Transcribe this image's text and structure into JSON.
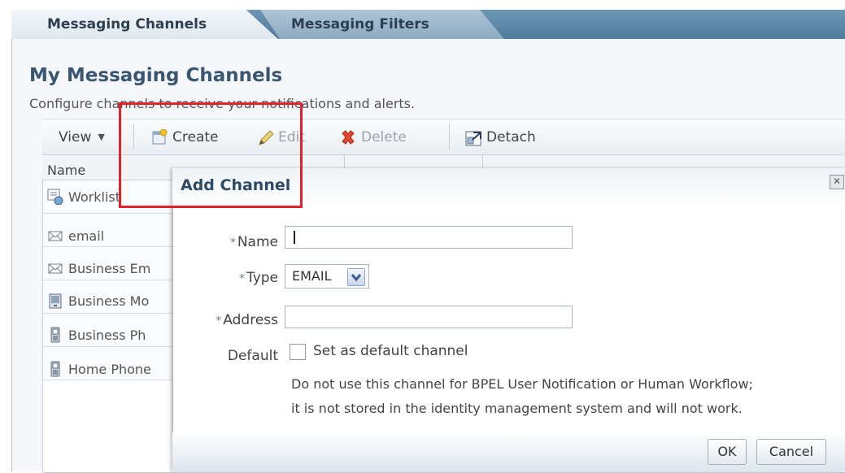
{
  "tabs": [
    {
      "label": "Messaging Channels",
      "active": true
    },
    {
      "label": "Messaging Filters",
      "active": false
    }
  ],
  "page": {
    "title": "My Messaging Channels",
    "subtitle": "Configure channels to receive your notifications and alerts."
  },
  "toolbar": {
    "view_label": "View",
    "create_label": "Create",
    "edit_label": "Edit",
    "delete_label": "Delete",
    "detach_label": "Detach"
  },
  "table": {
    "column_name": "Name",
    "rows": [
      {
        "label": "Worklist",
        "icon": "worklist-icon"
      },
      {
        "label": "email",
        "icon": "envelope-icon"
      },
      {
        "label": "Business Em",
        "icon": "envelope-icon"
      },
      {
        "label": "Business Mo",
        "icon": "mobile-icon"
      },
      {
        "label": "Business Ph",
        "icon": "phone-icon"
      },
      {
        "label": "Home Phone",
        "icon": "phone-icon"
      }
    ]
  },
  "dialog": {
    "title": "Add Channel",
    "required_marker": "*",
    "name_label": "Name",
    "name_value": "",
    "type_label": "Type",
    "type_value": "EMAIL",
    "address_label": "Address",
    "address_value": "",
    "default_label": "Default",
    "default_checkbox_label": "Set as default channel",
    "note_line1": "Do not use this channel for BPEL User Notification or Human Workflow;",
    "note_line2": "it is not stored in the identity management system and will not work.",
    "ok_label": "OK",
    "cancel_label": "Cancel"
  },
  "colors": {
    "tab_bar": "#4f7b9b",
    "title": "#3a5670",
    "highlight": "#e0222a"
  }
}
